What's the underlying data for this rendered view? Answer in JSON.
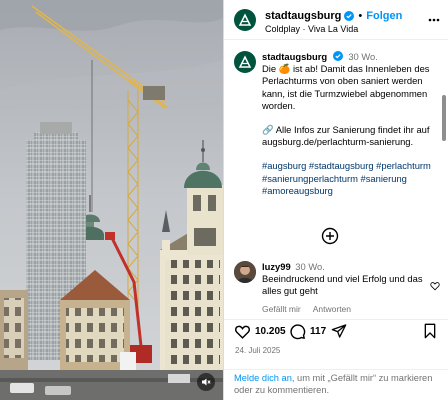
{
  "post": {
    "username": "stadtaugsburg",
    "follow_label": "Folgen",
    "song": "Coldplay · Viva La Vida",
    "caption_time": "30 Wo.",
    "caption_lines": [
      "Die 🍊 ist ab! Damit das Innenleben des Perlachturms von oben saniert werden kann, ist die Turmzwiebel abgenommen worden.",
      "🔗 Alle Infos zur Sanierung findet ihr auf augsburg.de/perlachturm-sanierung.",
      "#augsburg #stadtaugsburg #perlachturm #sanierungperlachturm #sanierung #amoreaugsburg"
    ]
  },
  "comment": {
    "username": "luzy99",
    "time": "30 Wo.",
    "text": "Beeindruckend und viel Erfolg und das alles gut geht",
    "likes_label": "Gefällt mir",
    "reply_label": "Antworten"
  },
  "actions": {
    "likes": "10.205",
    "comments": "117",
    "date": "24. Juli 2025"
  },
  "login": {
    "link": "Melde dich an,",
    "rest": " um mit „Gefällt mir“ zu markieren oder zu kommentieren."
  },
  "icons": [
    "verified-icon",
    "more-icon",
    "load-more-icon",
    "heart-icon",
    "comment-icon",
    "share-icon",
    "save-icon",
    "mute-icon"
  ],
  "colors": {
    "accent": "#0095f6",
    "hashtag": "#00376b",
    "brand": "#00533c",
    "muted": "#737373"
  }
}
